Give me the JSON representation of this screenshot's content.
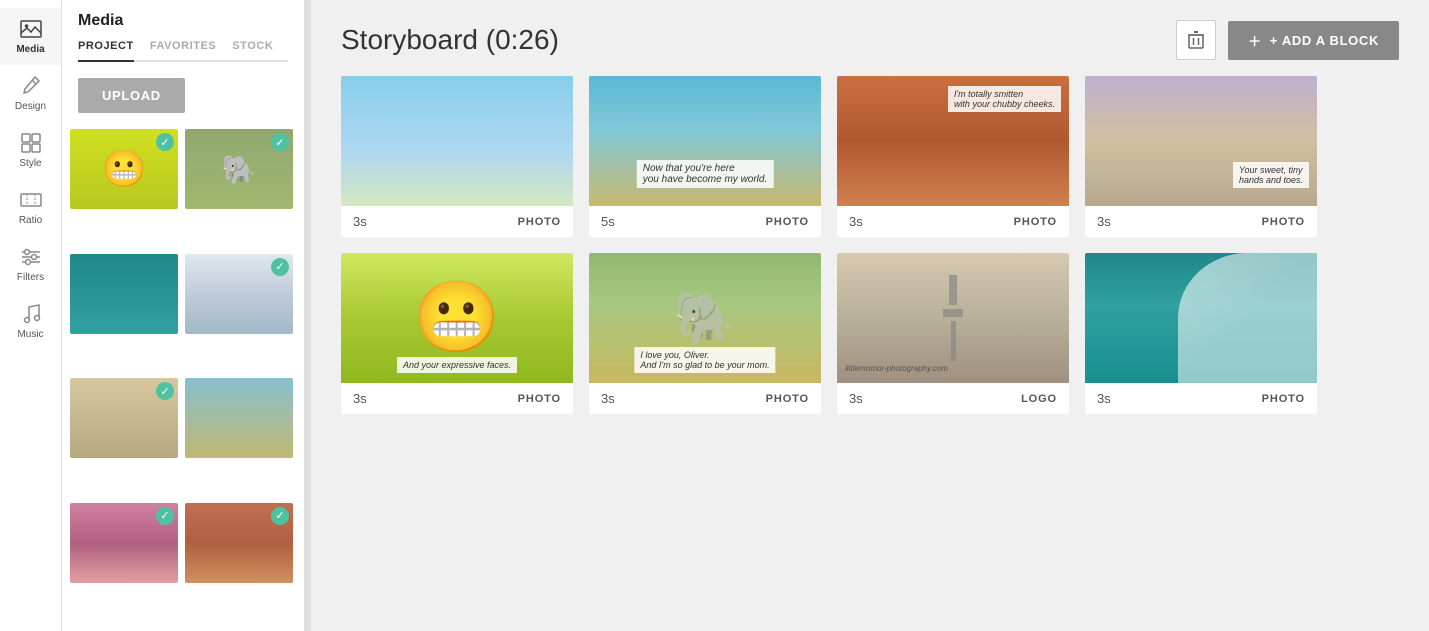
{
  "iconSidebar": {
    "items": [
      {
        "id": "media",
        "label": "Media",
        "icon": "image",
        "active": true
      },
      {
        "id": "design",
        "label": "Design",
        "icon": "brush",
        "active": false
      },
      {
        "id": "style",
        "label": "Style",
        "icon": "grid",
        "active": false
      },
      {
        "id": "ratio",
        "label": "Ratio",
        "icon": "ratio",
        "active": false
      },
      {
        "id": "filters",
        "label": "Filters",
        "icon": "filters",
        "active": false
      },
      {
        "id": "music",
        "label": "Music",
        "icon": "music",
        "active": false
      }
    ]
  },
  "leftPanel": {
    "title": "Media",
    "tabs": [
      {
        "id": "project",
        "label": "PROJECT",
        "active": true
      },
      {
        "id": "favorites",
        "label": "FAVORITES",
        "active": false
      },
      {
        "id": "stock",
        "label": "STOCK",
        "active": false
      }
    ],
    "uploadButton": "UPLOAD",
    "mediaItems": [
      {
        "id": 1,
        "color": "emoji",
        "checked": true
      },
      {
        "id": 2,
        "color": "elephant",
        "checked": true
      },
      {
        "id": 3,
        "color": "wave-teal",
        "checked": false
      },
      {
        "id": 4,
        "color": "wave-white",
        "checked": true
      },
      {
        "id": 5,
        "color": "statue",
        "checked": true
      },
      {
        "id": 6,
        "color": "beach",
        "checked": false
      },
      {
        "id": 7,
        "color": "mountain",
        "checked": true
      },
      {
        "id": 8,
        "color": "canyon",
        "checked": true
      }
    ]
  },
  "main": {
    "title": "Storyboard (0:26)",
    "deleteButton": "delete",
    "addBlockButton": "+ ADD A BLOCK",
    "rows": [
      {
        "cards": [
          {
            "id": 1,
            "duration": "3s",
            "type": "PHOTO",
            "imgClass": "img-sky",
            "overlayText": ""
          },
          {
            "id": 2,
            "duration": "5s",
            "type": "PHOTO",
            "imgClass": "img-coast",
            "overlayText": "Now that you're here you have become my world."
          },
          {
            "id": 3,
            "duration": "3s",
            "type": "PHOTO",
            "imgClass": "img-canyon",
            "overlayText": "I'm totally smitten with your chubby cheeks."
          },
          {
            "id": 4,
            "duration": "3s",
            "type": "PHOTO",
            "imgClass": "img-rocks",
            "overlayText": "Your sweet, tiny hands and toes."
          }
        ]
      },
      {
        "cards": [
          {
            "id": 5,
            "duration": "3s",
            "type": "PHOTO",
            "imgClass": "img-emoji",
            "overlayText": "And your expressive faces."
          },
          {
            "id": 6,
            "duration": "3s",
            "type": "PHOTO",
            "imgClass": "img-elephant",
            "overlayText": "I love you, Oliver. And I'm so glad to be your mom."
          },
          {
            "id": 7,
            "duration": "3s",
            "type": "LOGO",
            "imgClass": "img-statue",
            "overlayText": ""
          },
          {
            "id": 8,
            "duration": "3s",
            "type": "PHOTO",
            "imgClass": "img-wave",
            "overlayText": ""
          }
        ]
      }
    ]
  }
}
